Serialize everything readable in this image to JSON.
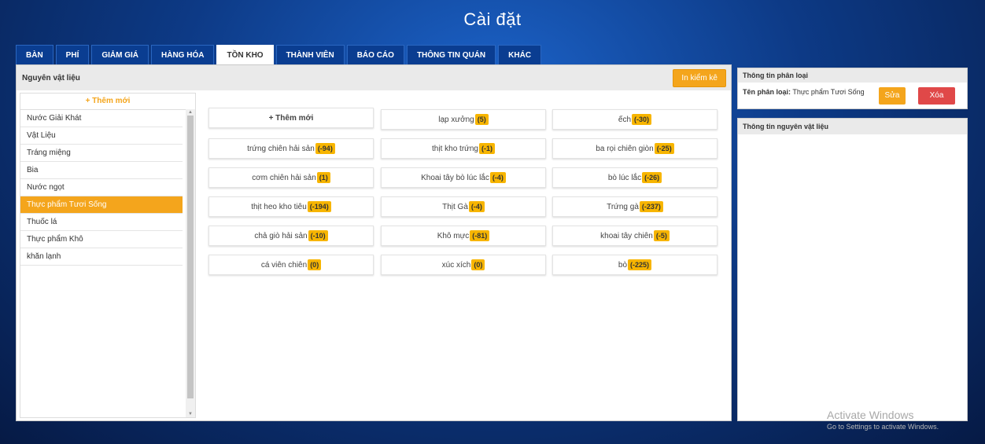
{
  "window": {
    "title": "Cài đặt"
  },
  "tabs": [
    {
      "label": "BÀN"
    },
    {
      "label": "PHÍ"
    },
    {
      "label": "GIẢM GIÁ"
    },
    {
      "label": "HÀNG HÓA"
    },
    {
      "label": "TỒN KHO",
      "active": true
    },
    {
      "label": "THÀNH VIÊN"
    },
    {
      "label": "BÁO CÁO"
    },
    {
      "label": "THÔNG TIN QUÁN"
    },
    {
      "label": "KHÁC"
    }
  ],
  "main": {
    "header_title": "Nguyên vật liệu",
    "print_button": "In kiểm kê",
    "add_new_left": "+ Thêm mới",
    "categories": [
      "Nước Giải Khát",
      "Vật Liệu",
      "Tráng miệng",
      "Bia",
      "Nước ngọt",
      "Thực phẩm Tươi Sống",
      "Thuốc lá",
      "Thực phẩm Khô",
      "khăn lạnh"
    ],
    "selected_category": "Thực phẩm Tươi Sống",
    "add_new_item": "+ Thêm mới",
    "items": [
      {
        "name": "lạp xưởng",
        "qty": "(5)"
      },
      {
        "name": "ếch",
        "qty": "(-30)"
      },
      {
        "name": "trứng chiên hải sản",
        "qty": "(-94)"
      },
      {
        "name": "thịt kho trứng",
        "qty": "(-1)"
      },
      {
        "name": "ba rọi chiên giòn",
        "qty": "(-25)"
      },
      {
        "name": "cơm chiên hải sản",
        "qty": "(1)"
      },
      {
        "name": "Khoai tây bò lúc lắc",
        "qty": "(-4)"
      },
      {
        "name": "bò lúc lắc",
        "qty": "(-26)"
      },
      {
        "name": "thịt heo kho tiêu",
        "qty": "(-194)"
      },
      {
        "name": "Thịt Gà",
        "qty": "(-4)"
      },
      {
        "name": "Trứng gà",
        "qty": "(-237)"
      },
      {
        "name": "chả giò hải sản",
        "qty": "(-10)"
      },
      {
        "name": "Khô mực",
        "qty": "(-81)"
      },
      {
        "name": "khoai tây chiên",
        "qty": "(-5)"
      },
      {
        "name": "cá viên chiên",
        "qty": "(0)"
      },
      {
        "name": "xúc xích",
        "qty": "(0)"
      },
      {
        "name": "bò",
        "qty": "(-225)"
      }
    ]
  },
  "right": {
    "classification_title": "Thông tin phân loại",
    "classification_label": "Tên phân loại:",
    "classification_value": "Thực phẩm Tươi Sống",
    "edit_button": "Sửa",
    "delete_button": "Xóa",
    "material_info_title": "Thông tin nguyên vật liệu"
  },
  "watermark": {
    "line1": "Activate Windows",
    "line2": "Go to Settings to activate Windows."
  },
  "colors": {
    "accent": "#f4a51c",
    "danger": "#e04848",
    "tab_bg": "#0a3d91",
    "badge": "#f7b500"
  }
}
